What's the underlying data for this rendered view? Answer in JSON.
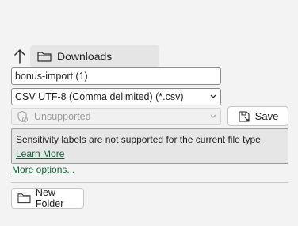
{
  "navigation": {
    "location_label": "Downloads"
  },
  "filename": {
    "value": "bonus-import (1)"
  },
  "file_type": {
    "selected": "CSV UTF-8 (Comma delimited) (*.csv)"
  },
  "sensitivity": {
    "selected": "Unsupported"
  },
  "buttons": {
    "save_label": "Save",
    "new_folder_label": "New Folder"
  },
  "info": {
    "message": "Sensitivity labels are not supported for the current file type.",
    "learn_more_label": "Learn More"
  },
  "links": {
    "more_options_label": "More options..."
  },
  "colors": {
    "background": "#f3f3f3",
    "link_green": "#185c37"
  }
}
